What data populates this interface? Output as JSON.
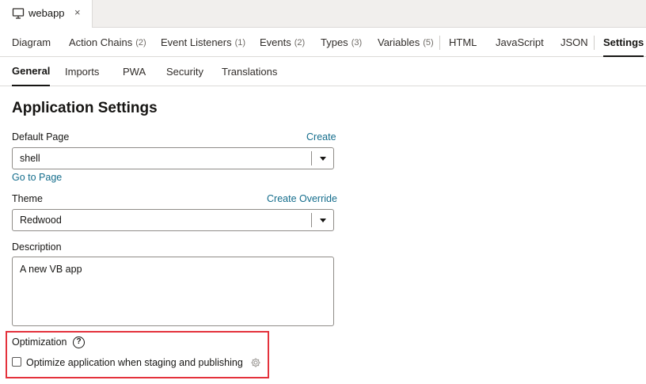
{
  "document_tab": {
    "title": "webapp",
    "close": "×"
  },
  "main_tabs": [
    {
      "label": "Diagram",
      "count": ""
    },
    {
      "label": "Action Chains",
      "count": "(2)"
    },
    {
      "label": "Event Listeners",
      "count": "(1)"
    },
    {
      "label": "Events",
      "count": "(2)"
    },
    {
      "label": "Types",
      "count": "(3)"
    },
    {
      "label": "Variables",
      "count": "(5)"
    },
    {
      "label": "HTML",
      "count": ""
    },
    {
      "label": "JavaScript",
      "count": ""
    },
    {
      "label": "JSON",
      "count": ""
    },
    {
      "label": "Settings",
      "count": ""
    }
  ],
  "sub_tabs": [
    {
      "label": "General"
    },
    {
      "label": "Imports"
    },
    {
      "label": "PWA"
    },
    {
      "label": "Security"
    },
    {
      "label": "Translations"
    }
  ],
  "page": {
    "title": "Application Settings"
  },
  "default_page": {
    "label": "Default Page",
    "create_link": "Create",
    "value": "shell",
    "go_link": "Go to Page"
  },
  "theme": {
    "label": "Theme",
    "override_link": "Create Override",
    "value": "Redwood"
  },
  "description": {
    "label": "Description",
    "value": "A new VB app"
  },
  "optimization": {
    "label": "Optimization",
    "help": "?",
    "checkbox_label": "Optimize application when staging and publishing",
    "checked": false
  },
  "colors": {
    "accent": "#146d8c",
    "highlight": "#e4323c",
    "active_tab": "#161513"
  }
}
